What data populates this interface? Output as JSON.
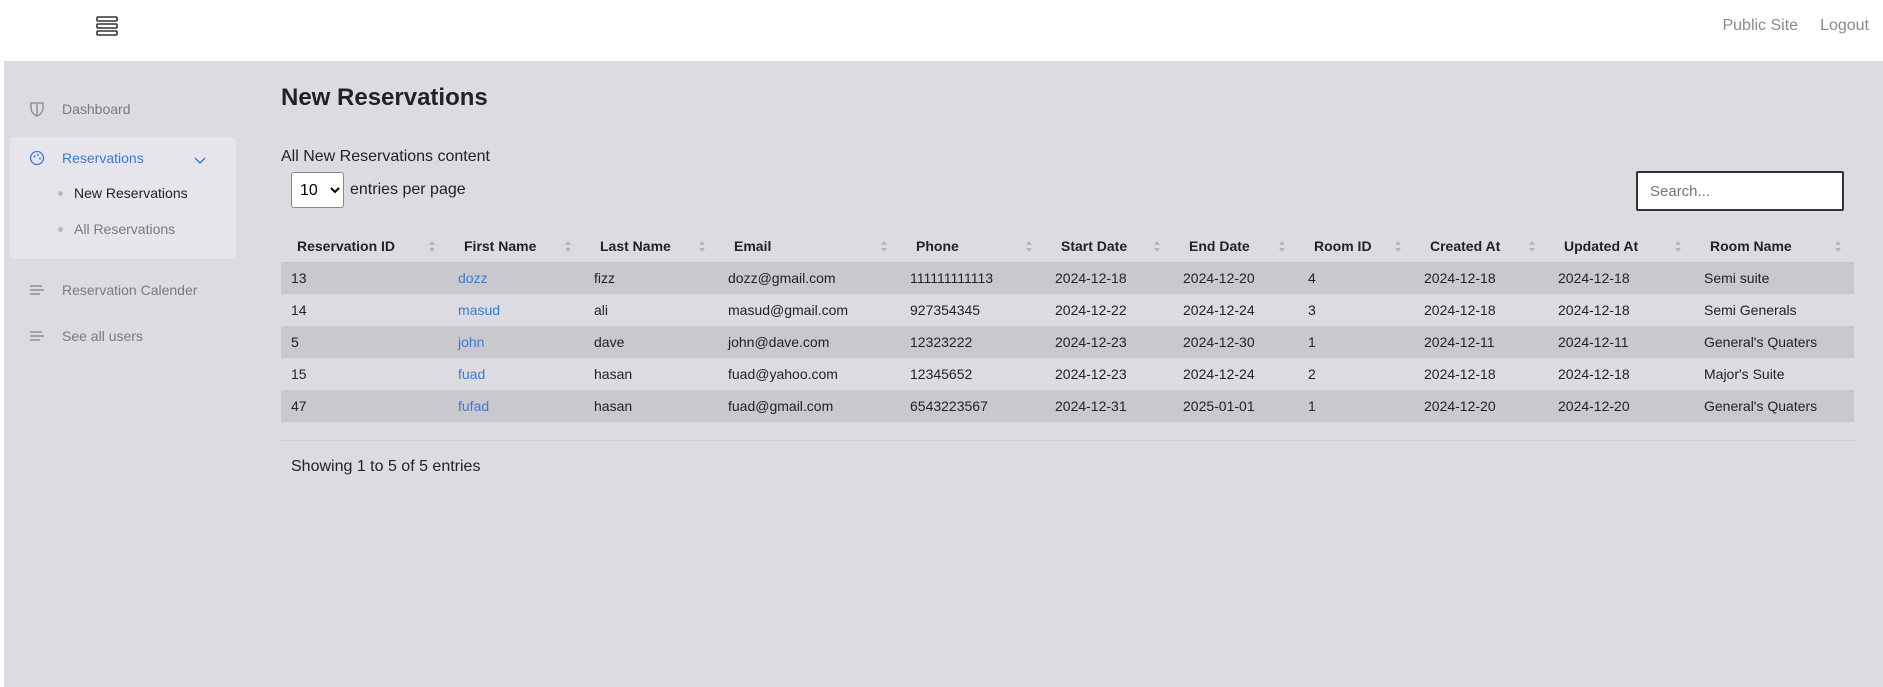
{
  "header": {
    "public_site": "Public Site",
    "logout": "Logout"
  },
  "sidebar": {
    "dashboard": "Dashboard",
    "reservations": "Reservations",
    "sub": {
      "new_reservations": "New Reservations",
      "all_reservations": "All Reservations"
    },
    "calender": "Reservation Calender",
    "users": "See all users"
  },
  "main": {
    "title": "New Reservations",
    "subtitle": "All New Reservations content",
    "per_page_value": "10",
    "per_page_label": "entries per page",
    "search_placeholder": "Search...",
    "info": "Showing 1 to 5 of 5 entries"
  },
  "table": {
    "columns": [
      "Reservation ID",
      "First Name",
      "Last Name",
      "Email",
      "Phone",
      "Start Date",
      "End Date",
      "Room ID",
      "Created At",
      "Updated At",
      "Room Name"
    ],
    "rows": [
      [
        "13",
        "dozz",
        "fizz",
        "dozz@gmail.com",
        "111111111113",
        "2024-12-18",
        "2024-12-20",
        "4",
        "2024-12-18",
        "2024-12-18",
        "Semi suite"
      ],
      [
        "14",
        "masud",
        "ali",
        "masud@gmail.com",
        "927354345",
        "2024-12-22",
        "2024-12-24",
        "3",
        "2024-12-18",
        "2024-12-18",
        "Semi Generals"
      ],
      [
        "5",
        "john",
        "dave",
        "john@dave.com",
        "12323222",
        "2024-12-23",
        "2024-12-30",
        "1",
        "2024-12-11",
        "2024-12-11",
        "General's Quaters"
      ],
      [
        "15",
        "fuad",
        "hasan",
        "fuad@yahoo.com",
        "12345652",
        "2024-12-23",
        "2024-12-24",
        "2",
        "2024-12-18",
        "2024-12-18",
        "Major's Suite"
      ],
      [
        "47",
        "fufad",
        "hasan",
        "fuad@gmail.com",
        "6543223567",
        "2024-12-31",
        "2025-01-01",
        "1",
        "2024-12-20",
        "2024-12-20",
        "General's Quaters"
      ]
    ]
  },
  "colors": {
    "accent": "#3a7bd5",
    "background": "#dcdbe1",
    "row_striped": "#c9c8cd"
  }
}
